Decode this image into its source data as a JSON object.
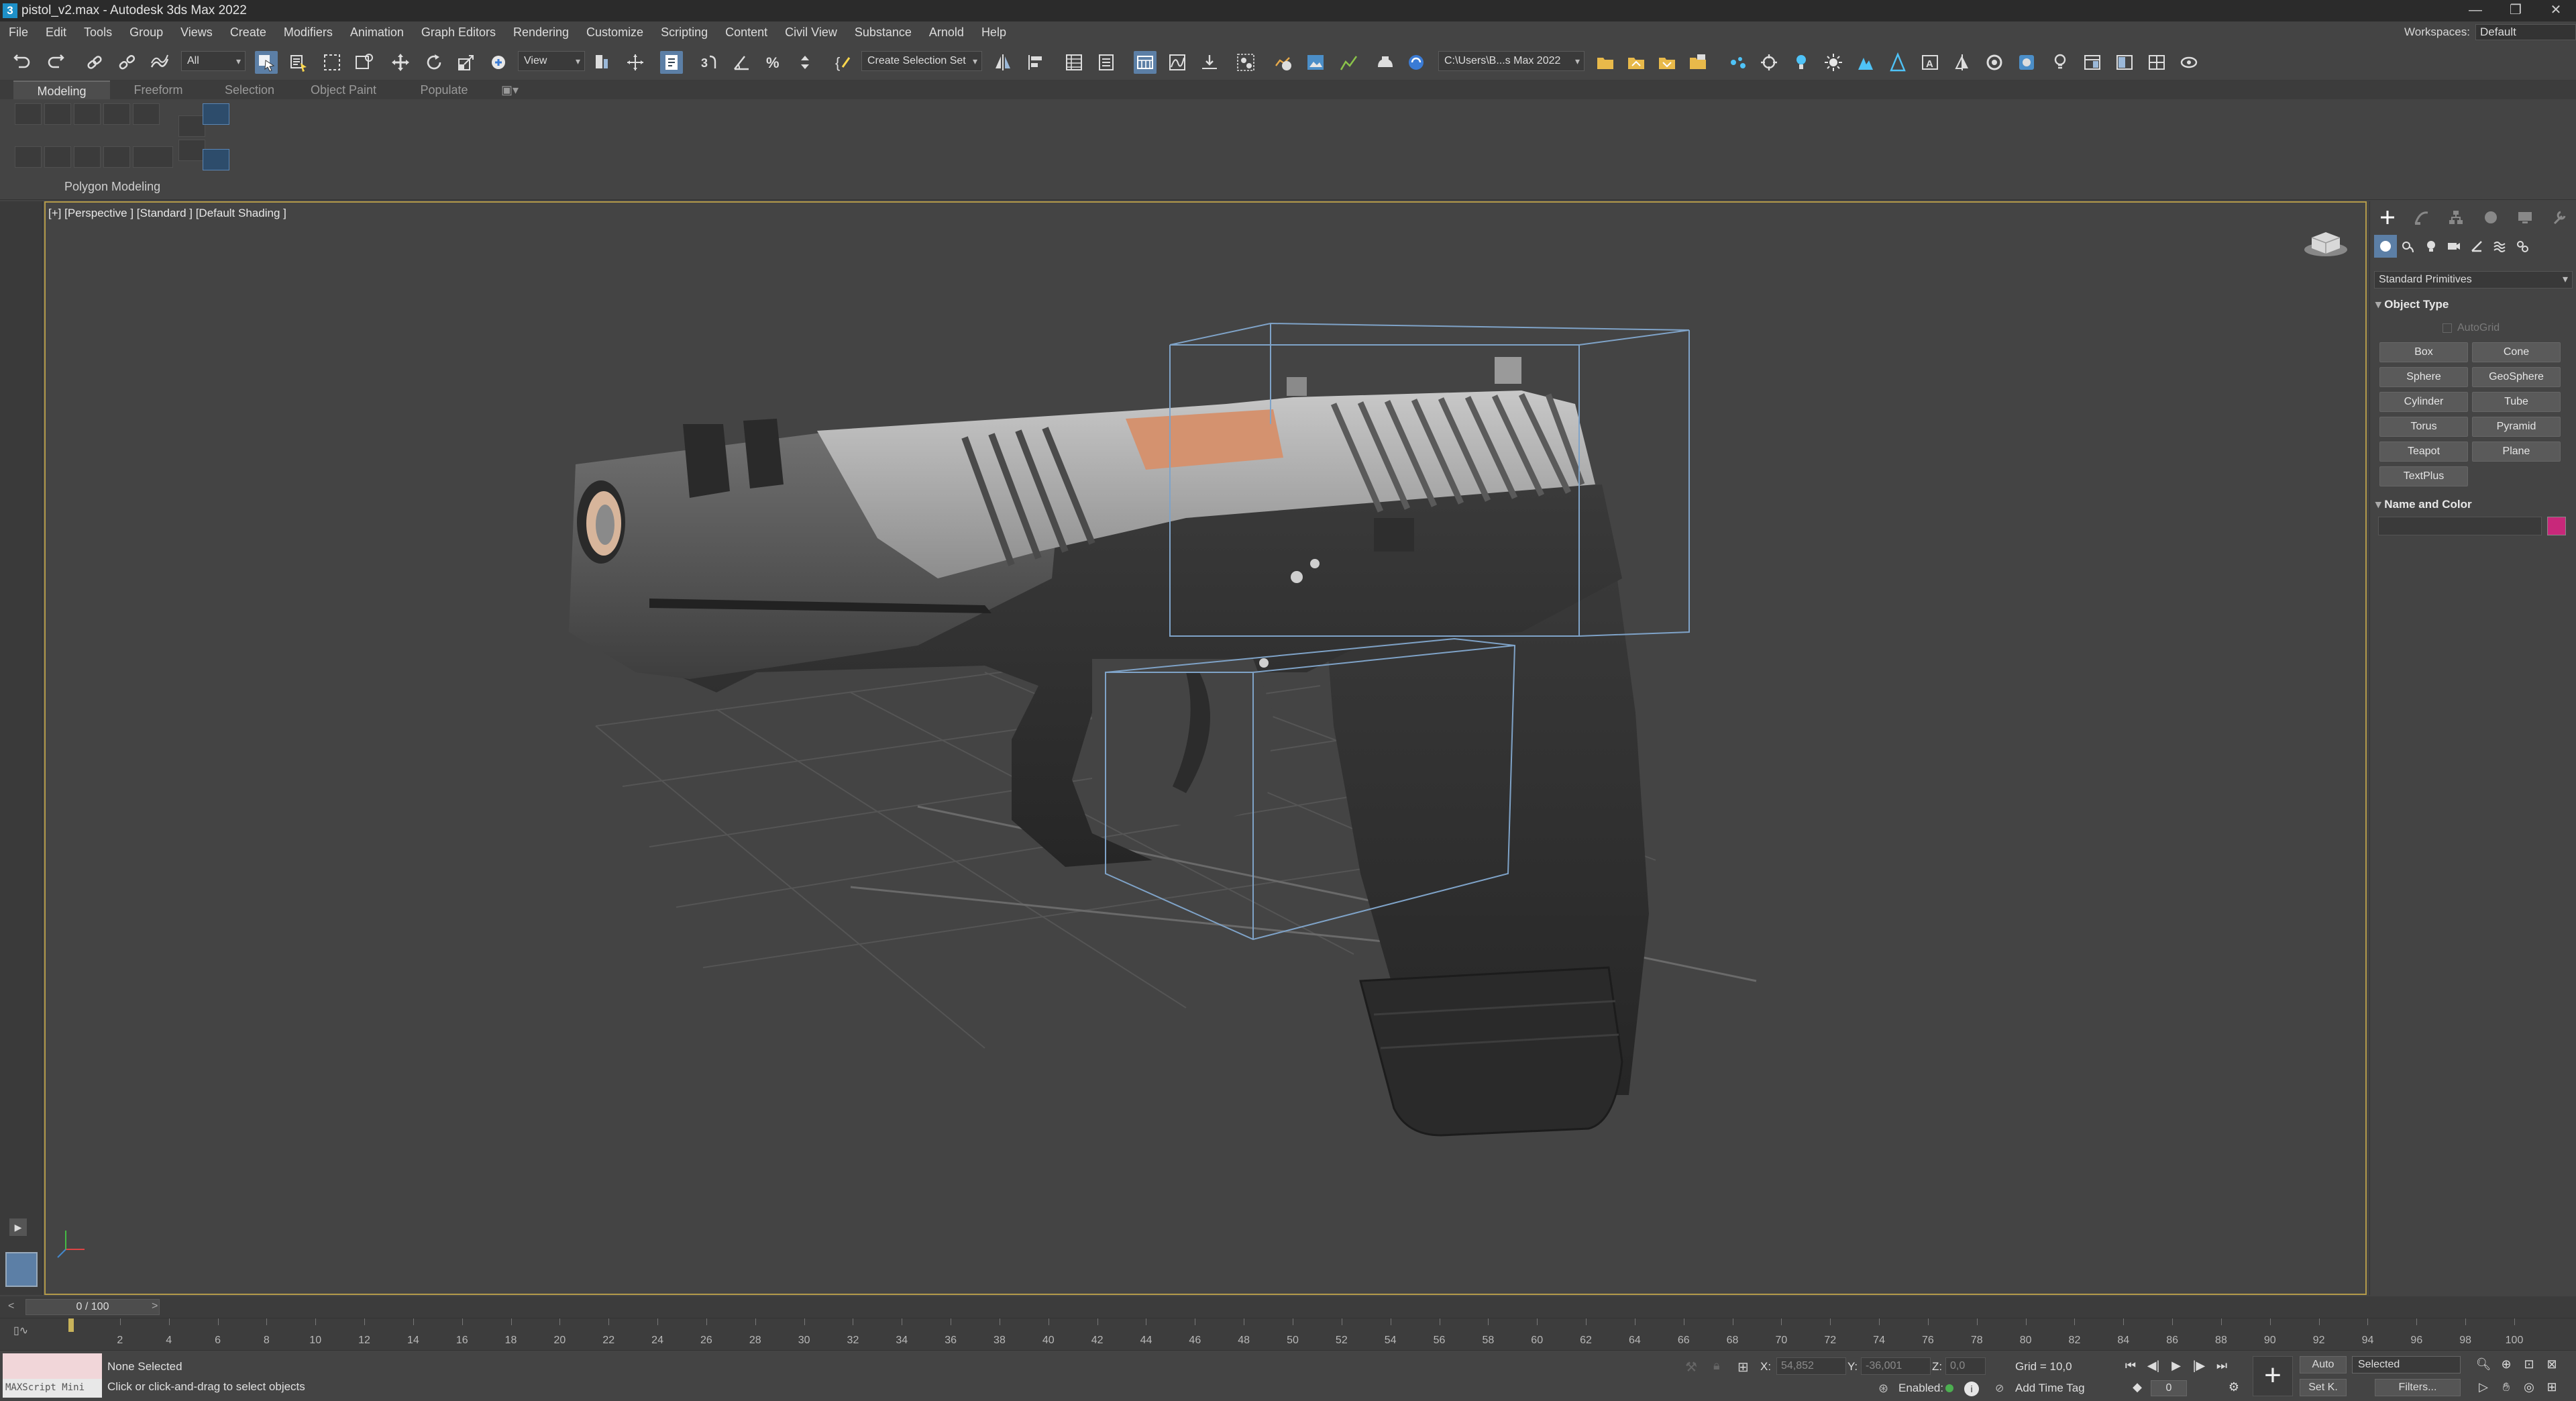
{
  "title_bar": {
    "title": "pistol_v2.max - Autodesk 3ds Max 2022",
    "app_icon": "3",
    "minimize_icon": "minimize-icon",
    "restore_icon": "restore-icon",
    "close_icon": "close-icon"
  },
  "menu": {
    "items": [
      "File",
      "Edit",
      "Tools",
      "Group",
      "Views",
      "Create",
      "Modifiers",
      "Animation",
      "Graph Editors",
      "Rendering",
      "Customize",
      "Scripting",
      "Content",
      "Civil View",
      "Substance",
      "Arnold",
      "Help"
    ],
    "workspaces_label": "Workspaces:",
    "workspace_value": "Default"
  },
  "toolbar": {
    "selection_filter": "All",
    "reference_coord": "View",
    "named_selection": "Create Selection Set",
    "project_path": "C:\\Users\\B...s Max 2022"
  },
  "ribbon": {
    "tabs": [
      "Modeling",
      "Freeform",
      "Selection",
      "Object Paint",
      "Populate"
    ],
    "active_tab": "Modeling",
    "panel_label": "Polygon Modeling"
  },
  "viewport": {
    "label": "[+] [Perspective ] [Standard ] [Default Shading ]"
  },
  "command_panel": {
    "dropdown": "Standard Primitives",
    "object_type_title": "Object Type",
    "autogrid_label": "AutoGrid",
    "primitives": [
      "Box",
      "Cone",
      "Sphere",
      "GeoSphere",
      "Cylinder",
      "Tube",
      "Torus",
      "Pyramid",
      "Teapot",
      "Plane",
      "TextPlus"
    ],
    "name_color_title": "Name and Color",
    "object_color": "#c8287a"
  },
  "timeline": {
    "frame_display": "0 / 100",
    "ticks": [
      "2",
      "4",
      "6",
      "8",
      "10",
      "12",
      "14",
      "16",
      "18",
      "20",
      "22",
      "24",
      "26",
      "28",
      "30",
      "32",
      "34",
      "36",
      "38",
      "40",
      "42",
      "44",
      "46",
      "48",
      "50",
      "52",
      "54",
      "56",
      "58",
      "60",
      "62",
      "64",
      "66",
      "68",
      "70",
      "72",
      "74",
      "76",
      "78",
      "80",
      "82",
      "84",
      "86",
      "88",
      "90",
      "92",
      "94",
      "96",
      "98",
      "100"
    ]
  },
  "status": {
    "maxscript_label": "MAXScript Mini",
    "selection_status": "None Selected",
    "prompt": "Click or click-and-drag to select objects",
    "x_label": "X:",
    "x_value": "54,852",
    "y_label": "Y:",
    "y_value": "-36,001",
    "z_label": "Z:",
    "z_value": "0,0",
    "grid": "Grid = 10,0",
    "enabled_label": "Enabled:",
    "add_time_tag": "Add Time Tag",
    "auto_key": "Auto",
    "set_key": "Set K.",
    "key_filter_value": "Selected",
    "filters": "Filters...",
    "current_frame": "0"
  },
  "colors": {
    "accent_blue": "#5c7fa6",
    "viewport_border": "#b39a4a",
    "copper": "#d4926f"
  }
}
